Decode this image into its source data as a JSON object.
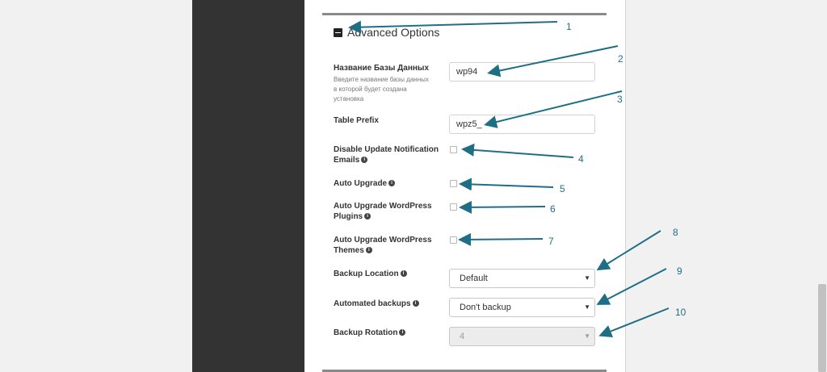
{
  "section": {
    "title": "Advanced Options"
  },
  "fields": {
    "db_name": {
      "label": "Название Базы Данных",
      "help": "Введите название базы данных в которой будет создана установка",
      "value": "wp94"
    },
    "table_prefix": {
      "label": "Table Prefix",
      "value": "wpz5_"
    },
    "disable_update_emails": {
      "label": "Disable Update Notification Emails"
    },
    "auto_upgrade": {
      "label": "Auto Upgrade"
    },
    "auto_upgrade_plugins": {
      "label": "Auto Upgrade WordPress Plugins"
    },
    "auto_upgrade_themes": {
      "label": "Auto Upgrade WordPress Themes"
    },
    "backup_location": {
      "label": "Backup Location",
      "value": "Default"
    },
    "automated_backups": {
      "label": "Automated backups",
      "value": "Don't backup"
    },
    "backup_rotation": {
      "label": "Backup Rotation",
      "value": "4"
    }
  },
  "callouts": [
    "1",
    "2",
    "3",
    "4",
    "5",
    "6",
    "7",
    "8",
    "9",
    "10"
  ],
  "colors": {
    "arrow": "#1e6f86",
    "sidebar": "#333333"
  },
  "icons": {
    "info": "info-icon",
    "collapse": "minus-box-icon",
    "caret": "caret-down-icon"
  }
}
